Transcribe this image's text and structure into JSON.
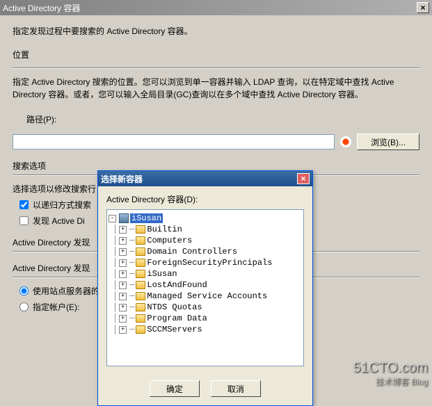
{
  "window": {
    "title": "Active Directory 容器",
    "close": "×"
  },
  "main": {
    "instruction": "指定发现过程中要搜索的 Active Directory 容器。",
    "location_label": "位置",
    "location_desc": "指定 Active Directory 搜索的位置。您可以浏览到单一容器并输入 LDAP 查询，以在特定域中查找 Active Directory 容器。或者，您可以输入全局目录(GC)查询以在多个域中查找 Active Directory 容器。",
    "path_label": "路径(P):",
    "path_value": "",
    "browse_btn": "浏览(B)...",
    "search_options_label": "搜索选项",
    "modify_search_desc": "选择选项以修改搜索行",
    "cb_recursive": "以递归方式搜索",
    "cb_discover": "发现 Active Di",
    "discover_heading1": "Active Directory 发现",
    "discover_heading2": "Active Directory 发现",
    "radio_site": "使用站点服务器的",
    "radio_account": "指定帐户(E):"
  },
  "modal": {
    "title": "选择新容器",
    "close": "×",
    "prompt": "Active Directory 容器(D):",
    "ok": "确定",
    "cancel": "取消",
    "tree": {
      "root": "iSusan",
      "children": [
        "Builtin",
        "Computers",
        "Domain Controllers",
        "ForeignSecurityPrincipals",
        "iSusan",
        "LostAndFound",
        "Managed Service Accounts",
        "NTDS Quotas",
        "Program Data",
        "SCCMServers"
      ]
    }
  },
  "watermark": {
    "main": "51CTO.com",
    "sub": "技术博客   Blog"
  }
}
